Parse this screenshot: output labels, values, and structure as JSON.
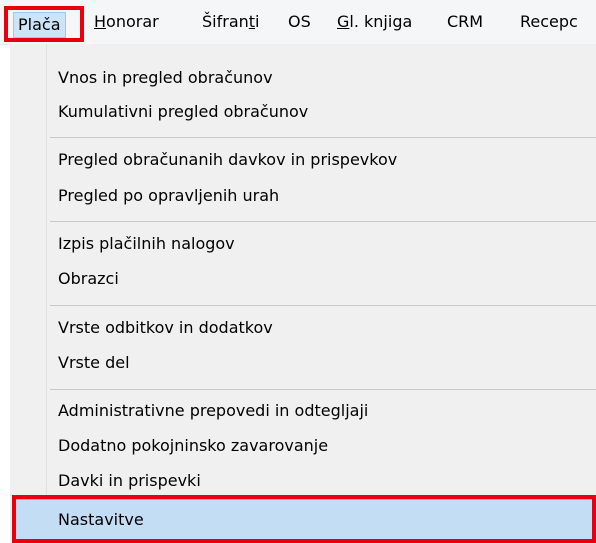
{
  "menubar": {
    "items": [
      {
        "label": "Plača"
      },
      {
        "underlined": "H",
        "rest": "onorar"
      },
      {
        "label_before": "Šifran",
        "underlined": "t",
        "label_after": "i"
      },
      {
        "label": "OS"
      },
      {
        "underlined": "G",
        "rest": "l. knjiga"
      },
      {
        "label": "CRM"
      },
      {
        "label": "Recepc"
      }
    ]
  },
  "dropdown": {
    "items": [
      "Vnos in pregled obračunov",
      "Kumulativni pregled obračunov",
      "Pregled obračunanih davkov in prispevkov",
      "Pregled po opravljenih urah",
      "Izpis plačilnih nalogov",
      "Obrazci",
      "Vrste odbitkov in dodatkov",
      "Vrste del",
      "Administrativne prepovedi in odtegljaji",
      "Dodatno pokojninsko zavarovanje",
      "Davki in prispevki",
      "Nastavitve"
    ]
  },
  "colors": {
    "highlight_red": "#e8000e",
    "selection_blue": "#c3ddf5",
    "active_menu_blue": "#cce4f7"
  }
}
